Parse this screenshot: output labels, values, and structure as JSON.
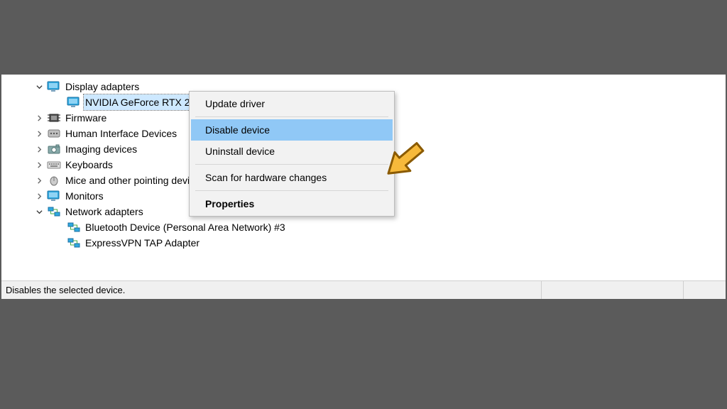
{
  "tree": {
    "items": [
      {
        "label": "Display adapters",
        "expanded": true,
        "icon": "display"
      },
      {
        "label": "NVIDIA GeForce RTX 2080",
        "child": true,
        "icon": "display",
        "selected": true
      },
      {
        "label": "Firmware",
        "expanded": false,
        "icon": "chip"
      },
      {
        "label": "Human Interface Devices",
        "expanded": false,
        "icon": "hid"
      },
      {
        "label": "Imaging devices",
        "expanded": false,
        "icon": "camera"
      },
      {
        "label": "Keyboards",
        "expanded": false,
        "icon": "keyboard"
      },
      {
        "label": "Mice and other pointing devices",
        "expanded": false,
        "icon": "mouse"
      },
      {
        "label": "Monitors",
        "expanded": false,
        "icon": "monitor"
      },
      {
        "label": "Network adapters",
        "expanded": true,
        "icon": "network"
      },
      {
        "label": "Bluetooth Device (Personal Area Network) #3",
        "child": true,
        "icon": "network"
      },
      {
        "label": "ExpressVPN TAP Adapter",
        "child": true,
        "icon": "network"
      }
    ]
  },
  "context_menu": {
    "items": {
      "update": "Update driver",
      "disable": "Disable device",
      "uninstall": "Uninstall device",
      "scan": "Scan for hardware changes",
      "properties": "Properties"
    },
    "highlighted": "disable"
  },
  "statusbar": {
    "text": "Disables the selected device."
  }
}
